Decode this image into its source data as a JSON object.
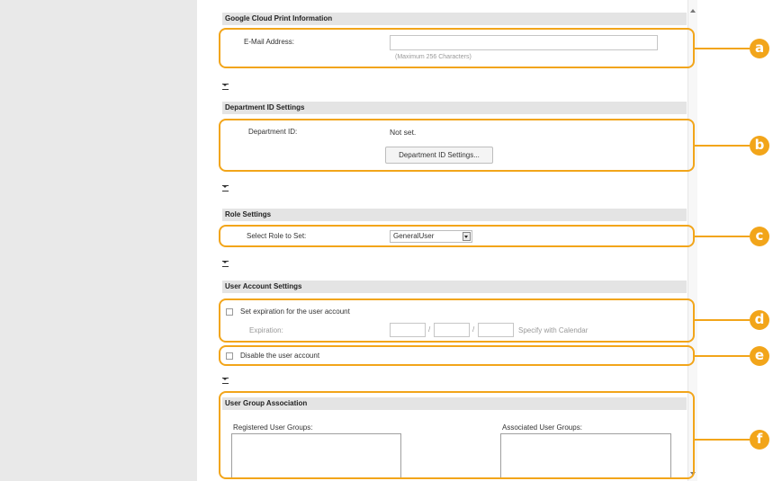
{
  "sections": {
    "google_cloud": {
      "title": "Google Cloud Print Information",
      "email_label": "E-Mail Address:",
      "email_value": "",
      "email_hint": "(Maximum 256 Characters)"
    },
    "department": {
      "title": "Department ID Settings",
      "id_label": "Department ID:",
      "id_value": "Not set.",
      "button": "Department ID Settings..."
    },
    "role": {
      "title": "Role Settings",
      "select_label": "Select Role to Set:",
      "selected": "GeneralUser"
    },
    "account": {
      "title": "User Account Settings",
      "expiration_checkbox": "Set expiration for the user account",
      "expiration_label": "Expiration:",
      "date_sep": "/",
      "calendar_link": "Specify with Calendar",
      "disable_checkbox": "Disable the user account"
    },
    "groups": {
      "title": "User Group Association",
      "registered_label": "Registered User Groups:",
      "associated_label": "Associated User Groups:"
    }
  },
  "callouts": [
    "a",
    "b",
    "c",
    "d",
    "e",
    "f"
  ],
  "colors": {
    "callout": "#f2a51a",
    "section_header": "#e4e4e4",
    "sidebar": "#e9e9e9"
  },
  "icons": {
    "collapse": "collapse-toggle-icon",
    "scroll_up": "scroll-up-arrow-icon",
    "scroll_down": "scroll-down-arrow-icon",
    "dropdown": "chevron-down-icon"
  }
}
